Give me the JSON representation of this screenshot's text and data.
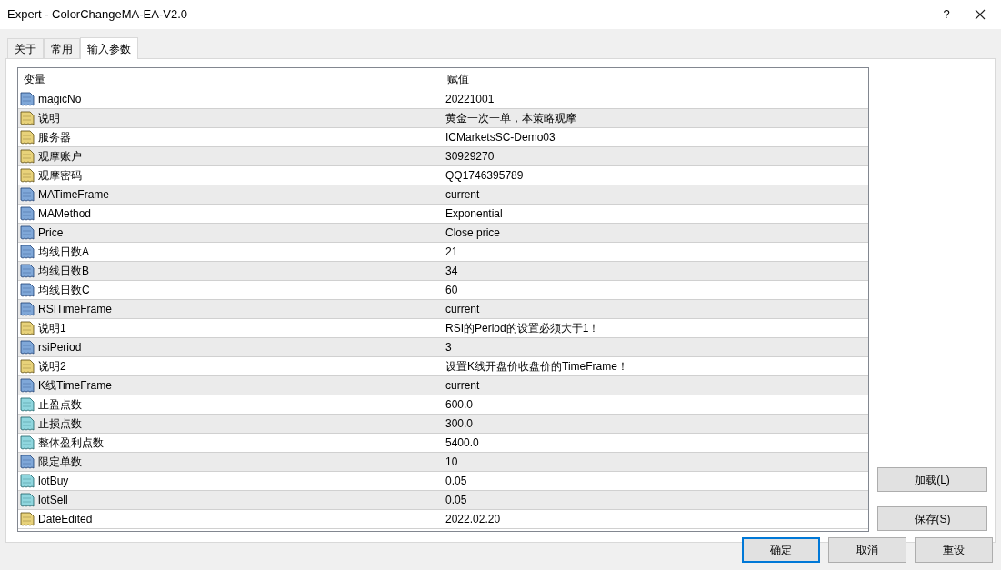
{
  "window": {
    "title": "Expert - ColorChangeMA-EA-V2.0",
    "help": "?"
  },
  "tabs": [
    {
      "label": "关于",
      "selected": false
    },
    {
      "label": "常用",
      "selected": false
    },
    {
      "label": "输入参数",
      "selected": true
    }
  ],
  "table": {
    "columns": [
      "变量",
      "赋值"
    ],
    "rows": [
      {
        "kind": "int",
        "name": "magicNo",
        "value": "20221001"
      },
      {
        "kind": "string",
        "name": "说明",
        "value": "黄金一次一单，本策略观摩"
      },
      {
        "kind": "string",
        "name": "服务器",
        "value": "ICMarketsSC-Demo03"
      },
      {
        "kind": "string",
        "name": "观摩账户",
        "value": "30929270"
      },
      {
        "kind": "string",
        "name": "观摩密码",
        "value": "QQ1746395789"
      },
      {
        "kind": "int",
        "name": "MATimeFrame",
        "value": "current"
      },
      {
        "kind": "int",
        "name": "MAMethod",
        "value": "Exponential"
      },
      {
        "kind": "int",
        "name": "Price",
        "value": "Close price"
      },
      {
        "kind": "int",
        "name": "均线日数A",
        "value": "21"
      },
      {
        "kind": "int",
        "name": "均线日数B",
        "value": "34"
      },
      {
        "kind": "int",
        "name": "均线日数C",
        "value": "60"
      },
      {
        "kind": "int",
        "name": "RSITimeFrame",
        "value": "current"
      },
      {
        "kind": "string",
        "name": "说明1",
        "value": "RSI的Period的设置必须大于1！"
      },
      {
        "kind": "int",
        "name": "rsiPeriod",
        "value": "3"
      },
      {
        "kind": "string",
        "name": "说明2",
        "value": "设置K线开盘价收盘价的TimeFrame！"
      },
      {
        "kind": "int",
        "name": "K线TimeFrame",
        "value": "current"
      },
      {
        "kind": "double",
        "name": "止盈点数",
        "value": "600.0"
      },
      {
        "kind": "double",
        "name": "止损点数",
        "value": "300.0"
      },
      {
        "kind": "double",
        "name": "整体盈利点数",
        "value": "5400.0"
      },
      {
        "kind": "int",
        "name": "限定单数",
        "value": "10"
      },
      {
        "kind": "double",
        "name": "lotBuy",
        "value": "0.05"
      },
      {
        "kind": "double",
        "name": "lotSell",
        "value": "0.05"
      },
      {
        "kind": "string",
        "name": "DateEdited",
        "value": "2022.02.20"
      }
    ]
  },
  "side_buttons": [
    "加载(L)",
    "保存(S)"
  ],
  "buttons": [
    {
      "label": "确定",
      "default": true
    },
    {
      "label": "取消",
      "default": false
    },
    {
      "label": "重设",
      "default": false
    }
  ]
}
